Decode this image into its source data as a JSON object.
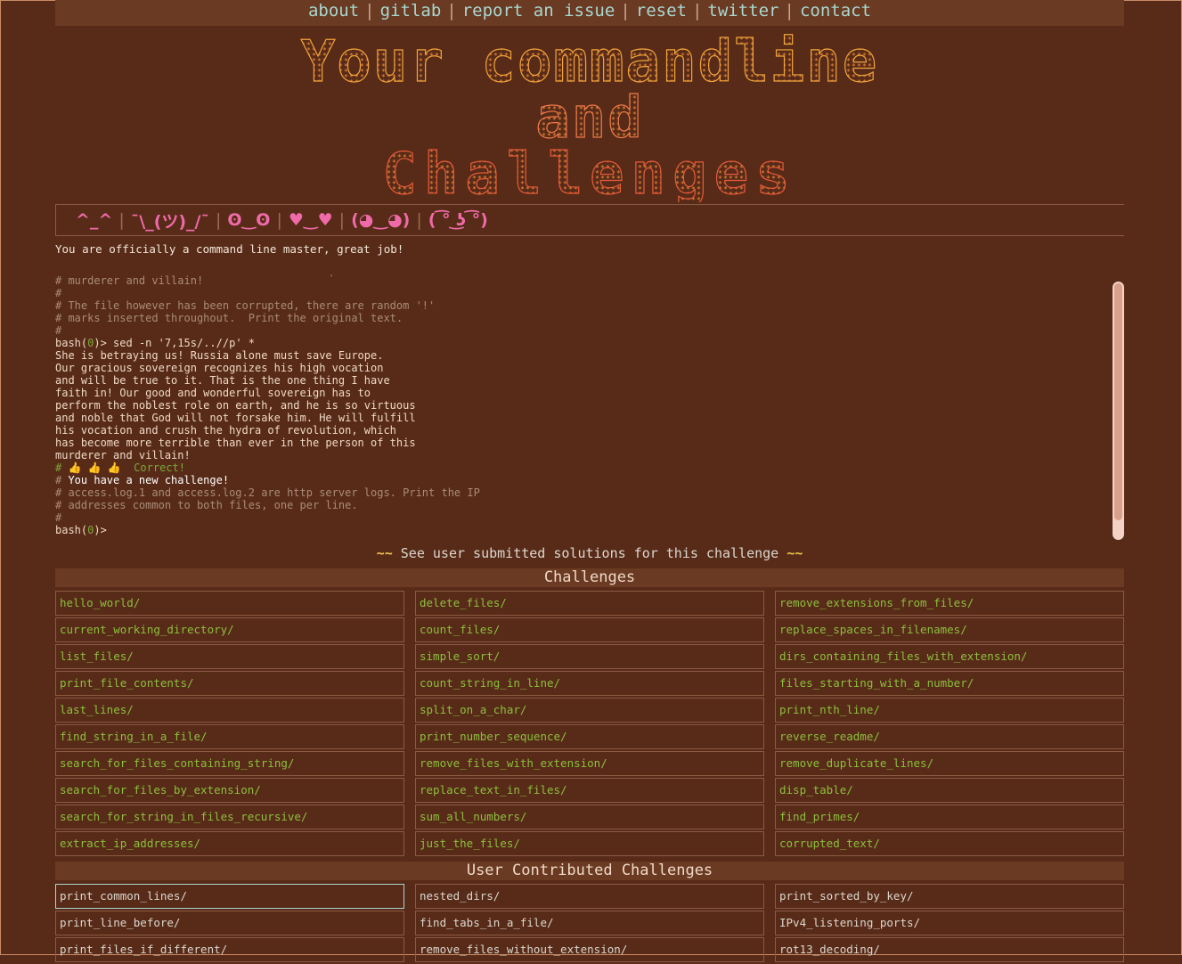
{
  "nav": {
    "links": [
      "about",
      "gitlab",
      "report an issue",
      "reset",
      "twitter",
      "contact"
    ],
    "separator": "|"
  },
  "banner": {
    "line1": "Your commandline",
    "line2": "and",
    "line3": "Challenges"
  },
  "faces": [
    "^_^",
    "¯\\_(ツ)_/¯",
    "ʘ‿ʘ",
    "♥‿♥",
    "(◕‿◕)",
    "( ͡° ͜ʖ ͡°)"
  ],
  "faces_sep": "|",
  "status_message": "You are officially a command line master, great job!",
  "terminal": {
    "tick": "'",
    "lines": [
      {
        "text": "# murderer and villain!",
        "style": "gray"
      },
      {
        "text": "#",
        "style": "gray"
      },
      {
        "text": "# The file however has been corrupted, there are random '!'",
        "style": "gray"
      },
      {
        "text": "# marks inserted throughout.  Print the original text.",
        "style": "gray"
      },
      {
        "text": "#",
        "style": "gray"
      },
      {
        "prompt_a": "bash(",
        "prompt_code": "0",
        "prompt_b": ")> ",
        "text": "sed -n '7,15s/..//p' *",
        "style": "prompt"
      },
      {
        "text": "She is betraying us! Russia alone must save Europe.",
        "style": "out"
      },
      {
        "text": "Our gracious sovereign recognizes his high vocation",
        "style": "out"
      },
      {
        "text": "and will be true to it. That is the one thing I have",
        "style": "out"
      },
      {
        "text": "faith in! Our good and wonderful sovereign has to",
        "style": "out"
      },
      {
        "text": "perform the noblest role on earth, and he is so virtuous",
        "style": "out"
      },
      {
        "text": "and noble that God will not forsake him. He will fulfill",
        "style": "out"
      },
      {
        "text": "his vocation and crush the hydra of revolution, which",
        "style": "out"
      },
      {
        "text": "has become more terrible than ever in the person of this",
        "style": "out"
      },
      {
        "text": "murderer and villain!",
        "style": "out"
      },
      {
        "text": "# 👍 👍 👍  Correct!",
        "style": "correct"
      },
      {
        "prefix": "# ",
        "text": "You have a new challenge!",
        "style": "newchal"
      },
      {
        "text": "# access.log.1 and access.log.2 are http server logs. Print the IP",
        "style": "gray"
      },
      {
        "text": "# addresses common to both files, one per line.",
        "style": "gray"
      },
      {
        "text": "#",
        "style": "gray"
      },
      {
        "prompt_a": "bash(",
        "prompt_code": "0",
        "prompt_b": ")>",
        "text": "",
        "style": "prompt"
      }
    ]
  },
  "solutions_link": {
    "tilde_left": "~~",
    "text": "See user submitted solutions for this challenge",
    "tilde_right": "~~"
  },
  "challenges": {
    "title": "Challenges",
    "items": [
      "hello_world/",
      "delete_files/",
      "remove_extensions_from_files/",
      "current_working_directory/",
      "count_files/",
      "replace_spaces_in_filenames/",
      "list_files/",
      "simple_sort/",
      "dirs_containing_files_with_extension/",
      "print_file_contents/",
      "count_string_in_line/",
      "files_starting_with_a_number/",
      "last_lines/",
      "split_on_a_char/",
      "print_nth_line/",
      "find_string_in_a_file/",
      "print_number_sequence/",
      "reverse_readme/",
      "search_for_files_containing_string/",
      "remove_files_with_extension/",
      "remove_duplicate_lines/",
      "search_for_files_by_extension/",
      "replace_text_in_files/",
      "disp_table/",
      "search_for_string_in_files_recursive/",
      "sum_all_numbers/",
      "find_primes/",
      "extract_ip_addresses/",
      "just_the_files/",
      "corrupted_text/"
    ]
  },
  "user_challenges": {
    "title": "User Contributed Challenges",
    "items": [
      "print_common_lines/",
      "nested_dirs/",
      "print_sorted_by_key/",
      "print_line_before/",
      "find_tabs_in_a_file/",
      "IPv4_listening_ports/",
      "print_files_if_different/",
      "remove_files_without_extension/",
      "rot13_decoding/"
    ]
  },
  "colors": {
    "background": "#582b18",
    "header_bar": "#6a3a23",
    "link_green": "#8cbf3e",
    "face_pink": "#ef6aa9",
    "nav_link": "#a9d7cf"
  }
}
